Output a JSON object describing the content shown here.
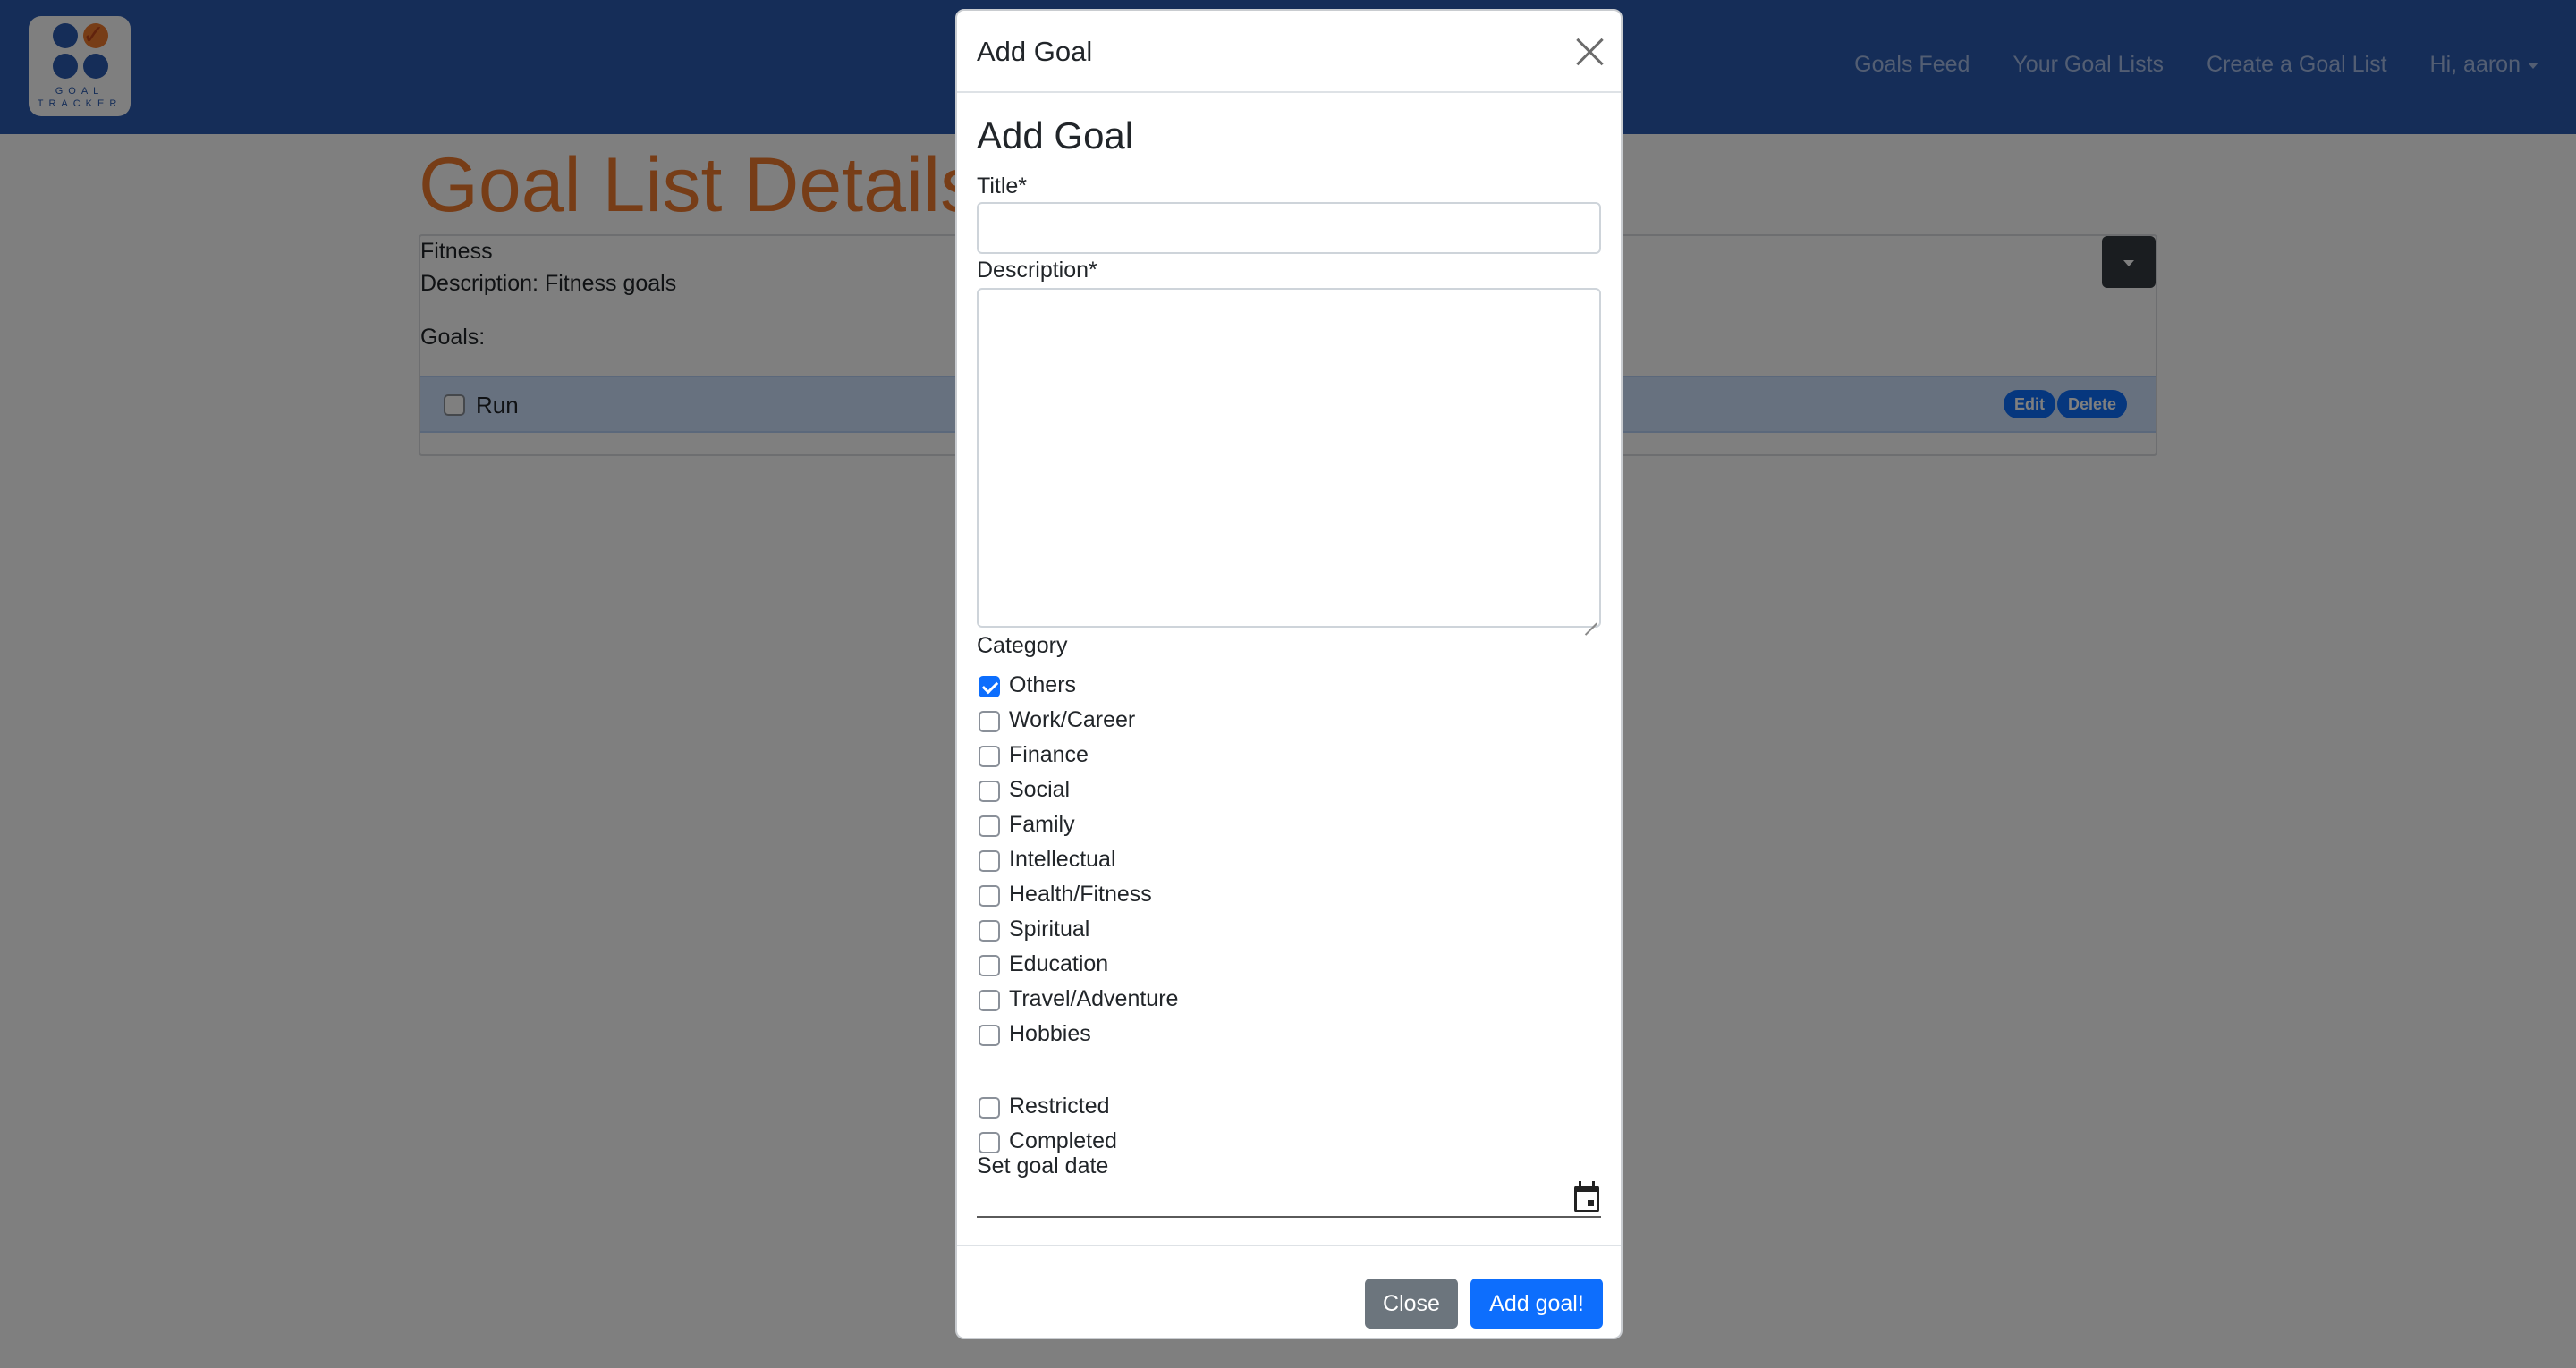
{
  "navbar": {
    "logo_lines": [
      "GOAL",
      "TRACKER"
    ],
    "links": [
      "Goals Feed",
      "Your Goal Lists",
      "Create a Goal List"
    ],
    "user_menu": "Hi, aaron"
  },
  "page": {
    "title": "Goal List Details",
    "list_name": "Fitness",
    "list_description": "Description: Fitness goals",
    "goals_label": "Goals:",
    "goals": [
      {
        "title": "Run",
        "completed": false,
        "edit_label": "Edit",
        "delete_label": "Delete"
      }
    ]
  },
  "modal": {
    "header_title": "Add Goal",
    "form_heading": "Add Goal",
    "title_label": "Title*",
    "title_value": "",
    "description_label": "Description*",
    "description_value": "",
    "category_label": "Category",
    "categories": [
      {
        "label": "Others",
        "checked": true
      },
      {
        "label": "Work/Career",
        "checked": false
      },
      {
        "label": "Finance",
        "checked": false
      },
      {
        "label": "Social",
        "checked": false
      },
      {
        "label": "Family",
        "checked": false
      },
      {
        "label": "Intellectual",
        "checked": false
      },
      {
        "label": "Health/Fitness",
        "checked": false
      },
      {
        "label": "Spiritual",
        "checked": false
      },
      {
        "label": "Education",
        "checked": false
      },
      {
        "label": "Travel/Adventure",
        "checked": false
      },
      {
        "label": "Hobbies",
        "checked": false
      }
    ],
    "restricted_label": "Restricted",
    "restricted_checked": false,
    "completed_label": "Completed",
    "completed_checked": false,
    "date_label": "Set goal date",
    "date_value": "",
    "close_button": "Close",
    "add_button": "Add goal!"
  },
  "colors": {
    "navbar": "#2b5bb0",
    "title_orange": "#ee7a2e",
    "primary": "#0d6efd",
    "secondary": "#6c757d"
  }
}
